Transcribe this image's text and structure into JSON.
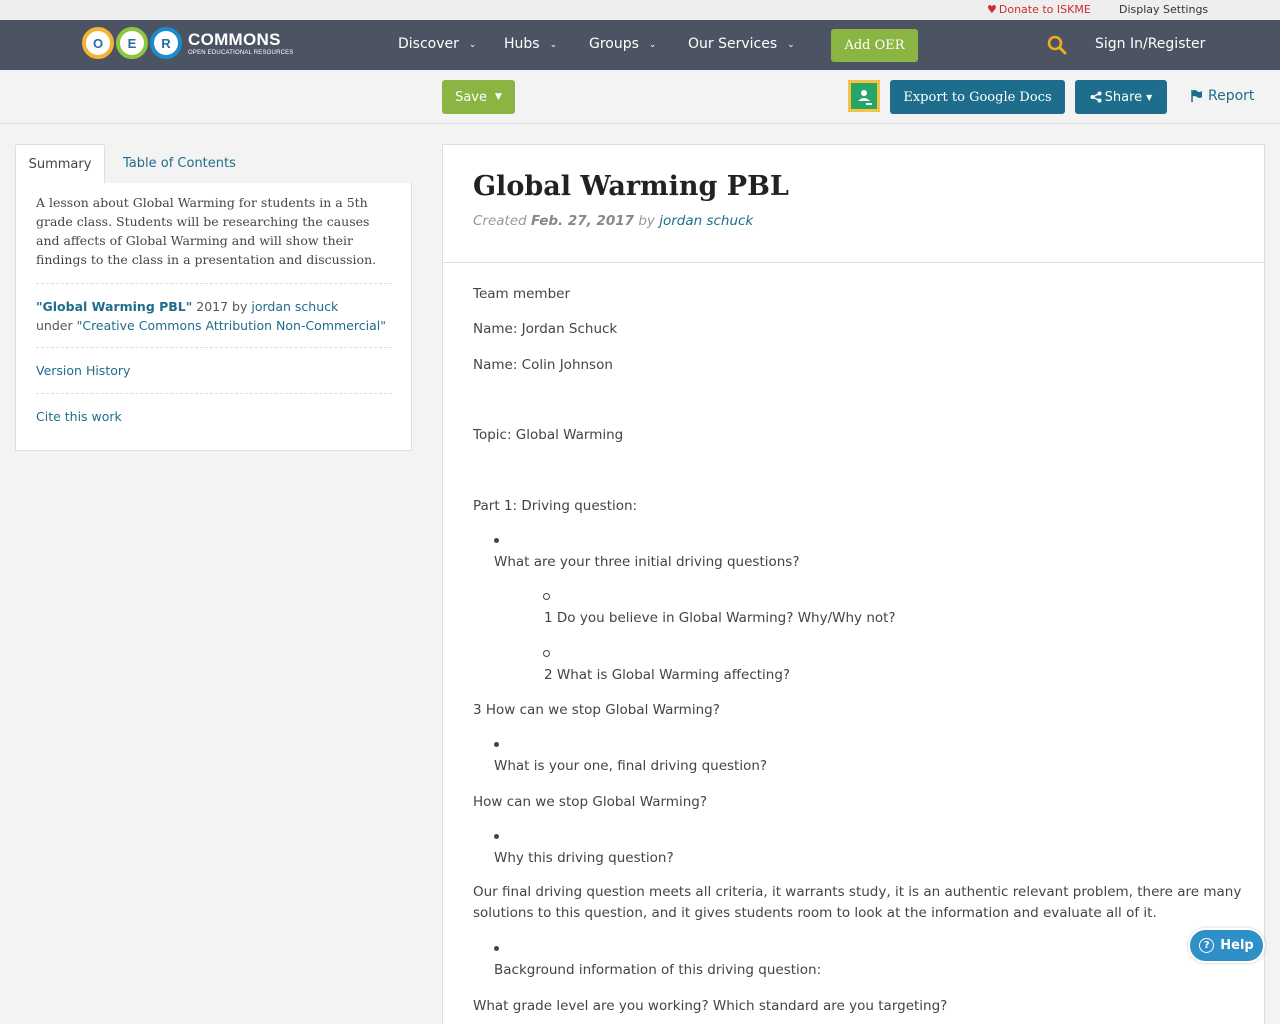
{
  "utility": {
    "donate": "Donate to ISKME",
    "display_settings": "Display Settings"
  },
  "logo": {
    "letters": [
      "O",
      "E",
      "R"
    ],
    "wordmark": "COMMONS",
    "tagline": "OPEN EDUCATIONAL RESOURCES"
  },
  "nav": {
    "discover": "Discover",
    "hubs": "Hubs",
    "groups": "Groups",
    "services": "Our Services",
    "add_oer": "Add OER",
    "signin": "Sign In/Register"
  },
  "toolbar": {
    "save": "Save",
    "export": "Export to Google Docs",
    "share": "Share",
    "report": "Report"
  },
  "sidebar": {
    "tab_summary": "Summary",
    "tab_toc": "Table of Contents",
    "description": "A lesson about Global Warming for students in a 5th grade class. Students will be researching the causes and affects of Global Warming and will show their findings to the class in a presentation and discussion.",
    "attribution": {
      "title": "\"Global Warming PBL\"",
      "year": " 2017 by ",
      "author": "jordan schuck",
      "under": "under ",
      "license": "\"Creative Commons Attribution Non-Commercial\""
    },
    "version_history": "Version History",
    "cite": "Cite this work"
  },
  "resource": {
    "title": "Global Warming PBL",
    "created_label": "Created ",
    "date": "Feb. 27, 2017",
    "by": " by ",
    "author": "jordan schuck"
  },
  "content": {
    "team_member": "Team member",
    "name1": "Name: Jordan Schuck",
    "name2": "Name: Colin Johnson",
    "topic": "Topic: Global Warming",
    "part1": "Part 1:  Driving question:",
    "q_initial": "What are your three initial driving questions?",
    "q1": "1 Do you believe in Global Warming? Why/Why not?",
    "q2": "2 What is Global Warming affecting?",
    "q3": "3 How can we stop Global Warming?",
    "q_final": "What is your one, final driving question?",
    "final_answer": "How can we stop Global Warming?",
    "q_why": "Why this driving question?",
    "why_answer": "Our final driving question meets all criteria, it warrants study, it is an authentic relevant problem, there are many solutions to this question, and it gives students room to look at the information and evaluate all of it.",
    "q_background": "Background information of this driving question:",
    "q_grade": "What grade level are you working? Which standard are you targeting?"
  },
  "help": {
    "label": "Help"
  },
  "colors": {
    "nav_bg": "#4c5463",
    "green": "#8bb543",
    "teal": "#1e6d8c",
    "help_blue": "#2f8fc7",
    "donate_red": "#c9302c"
  }
}
